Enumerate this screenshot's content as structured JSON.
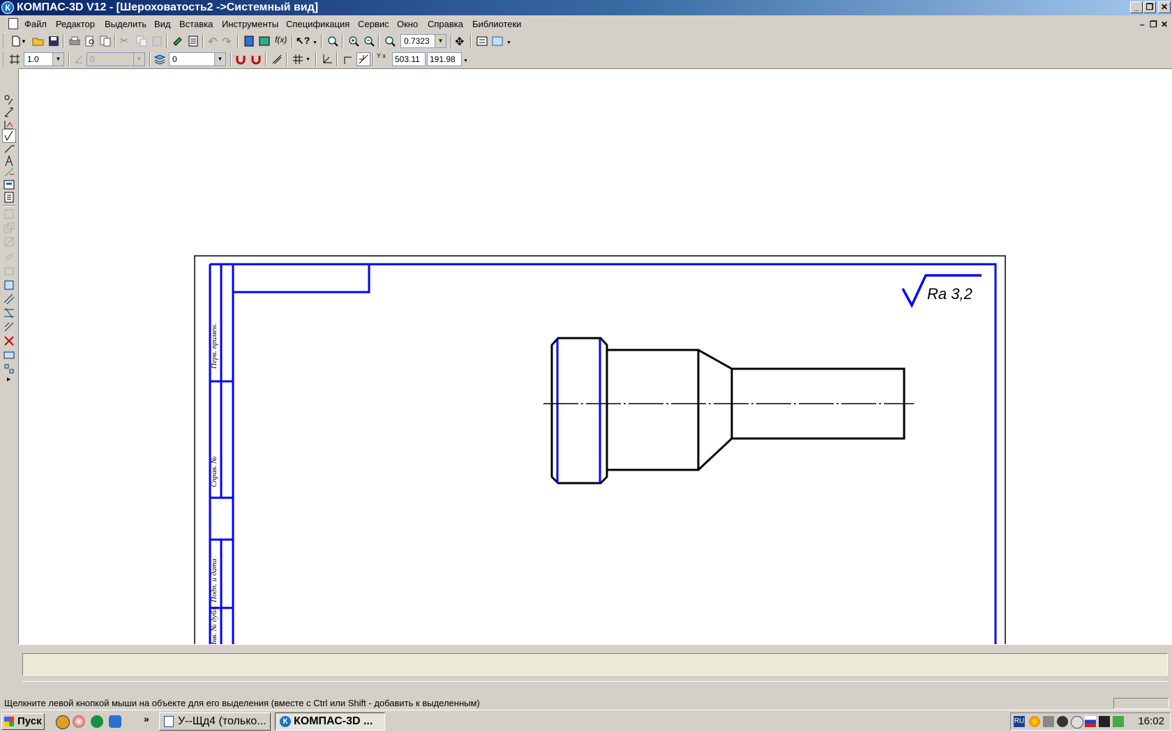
{
  "window": {
    "title": "КОМПАС-3D V12 - [Шероховатость2 ->Системный вид]",
    "app_icon_letter": "К",
    "caption_buttons": [
      "_",
      "❐",
      "✕"
    ]
  },
  "menu": {
    "items": [
      "Файл",
      "Редактор",
      "Выделить",
      "Вид",
      "Вставка",
      "Инструменты",
      "Спецификация",
      "Сервис",
      "Окно",
      "Справка",
      "Библиотеки"
    ]
  },
  "mdi_controls": [
    "–",
    "❐",
    "✕"
  ],
  "toolbar1": {
    "zoom_value": "0.7323"
  },
  "toolbar2": {
    "step_value": "1.0",
    "angle_value": "0",
    "layer_value": "0",
    "coord_label": "Y x",
    "coord_x": "503.11",
    "coord_y": "191.98"
  },
  "drawing": {
    "roughness_label": "Ra 3,2",
    "stamp_labels": [
      "Перв. примен.",
      "Справ. №",
      "Подп. и дата",
      "Инв. № дубл."
    ],
    "colors": {
      "frame": "#0000ff",
      "part": "#000000"
    }
  },
  "status": {
    "hint": "Щелкните левой кнопкой мыши на объекте для его выделения (вместе с Ctrl или Shift - добавить к выделенным)"
  },
  "taskbar": {
    "start_label": "Пуск",
    "chevron": "»",
    "tasks": [
      {
        "label": "У--Щд4 (только...",
        "active": false
      },
      {
        "label": "КОМПАС-3D ...",
        "active": true
      }
    ],
    "tray_lang": "RU",
    "clock": "16:02"
  }
}
